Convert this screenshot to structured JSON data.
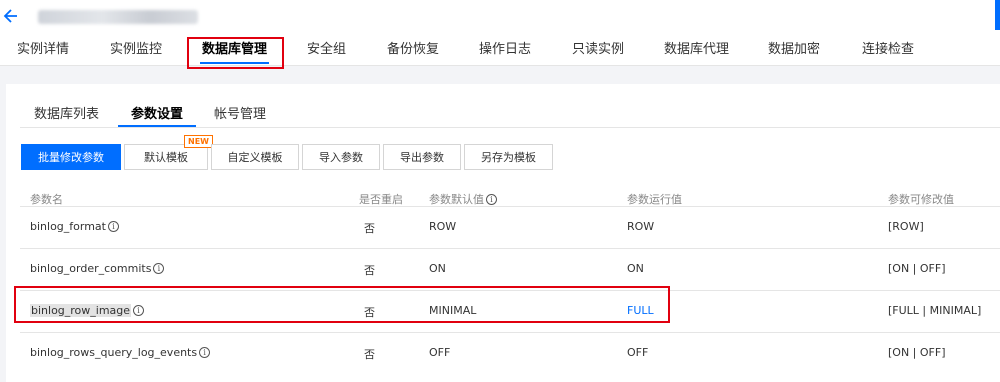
{
  "header": {
    "back_icon": "arrow-left-icon"
  },
  "tabs": [
    {
      "label": "实例详情",
      "active": false
    },
    {
      "label": "实例监控",
      "active": false
    },
    {
      "label": "数据库管理",
      "active": true
    },
    {
      "label": "安全组",
      "active": false
    },
    {
      "label": "备份恢复",
      "active": false
    },
    {
      "label": "操作日志",
      "active": false
    },
    {
      "label": "只读实例",
      "active": false
    },
    {
      "label": "数据库代理",
      "active": false
    },
    {
      "label": "数据加密",
      "active": false
    },
    {
      "label": "连接检查",
      "active": false
    }
  ],
  "subtabs": [
    {
      "label": "数据库列表",
      "active": false
    },
    {
      "label": "参数设置",
      "active": true
    },
    {
      "label": "帐号管理",
      "active": false
    }
  ],
  "toolbar": {
    "batch_edit": "批量修改参数",
    "default_template": "默认模板",
    "new_badge": "NEW",
    "custom_template": "自定义模板",
    "import": "导入参数",
    "export": "导出参数",
    "save_as_template": "另存为模板"
  },
  "table": {
    "headers": {
      "name": "参数名",
      "restart": "是否重启",
      "default": "参数默认值",
      "running": "参数运行值",
      "allowed": "参数可修改值"
    },
    "rows": [
      {
        "name": "binlog_format",
        "restart": "否",
        "default": "ROW",
        "running": "ROW",
        "allowed": "[ROW]"
      },
      {
        "name": "binlog_order_commits",
        "restart": "否",
        "default": "ON",
        "running": "ON",
        "allowed": "[ON | OFF]"
      },
      {
        "name": "binlog_row_image",
        "restart": "否",
        "default": "MINIMAL",
        "running": "FULL",
        "allowed": "[FULL | MINIMAL]"
      },
      {
        "name": "binlog_rows_query_log_events",
        "restart": "否",
        "default": "OFF",
        "running": "OFF",
        "allowed": "[ON | OFF]"
      }
    ]
  },
  "colors": {
    "accent": "#006eff",
    "highlight_border": "#e1000f",
    "badge": "#ff7200"
  }
}
